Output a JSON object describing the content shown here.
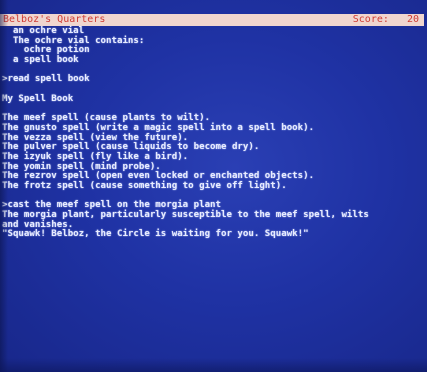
{
  "status_bar": {
    "location": "Belboz's Quarters",
    "score_label": "Score:",
    "score_value": "20"
  },
  "transcript": {
    "inventory_lines": [
      "  an ochre vial",
      "  The ochre vial contains:",
      "    ochre potion",
      "  a spell book"
    ],
    "command_read": ">read spell book",
    "book_title": "My Spell Book",
    "spells": [
      "The meef spell (cause plants to wilt).",
      "The gnusto spell (write a magic spell into a spell book).",
      "The vezza spell (view the future).",
      "The pulver spell (cause liquids to become dry).",
      "The izyuk spell (fly like a bird).",
      "The yomin spell (mind probe).",
      "The rezrov spell (open even locked or enchanted objects).",
      "The frotz spell (cause something to give off light)."
    ],
    "command_cast": ">cast the meef spell on the morgia plant",
    "result_lines": [
      "The morgia plant, particularly susceptible to the meef spell, wilts",
      "and vanishes.",
      "\"Squawk! Belboz, the Circle is waiting for you. Squawk!\""
    ]
  }
}
